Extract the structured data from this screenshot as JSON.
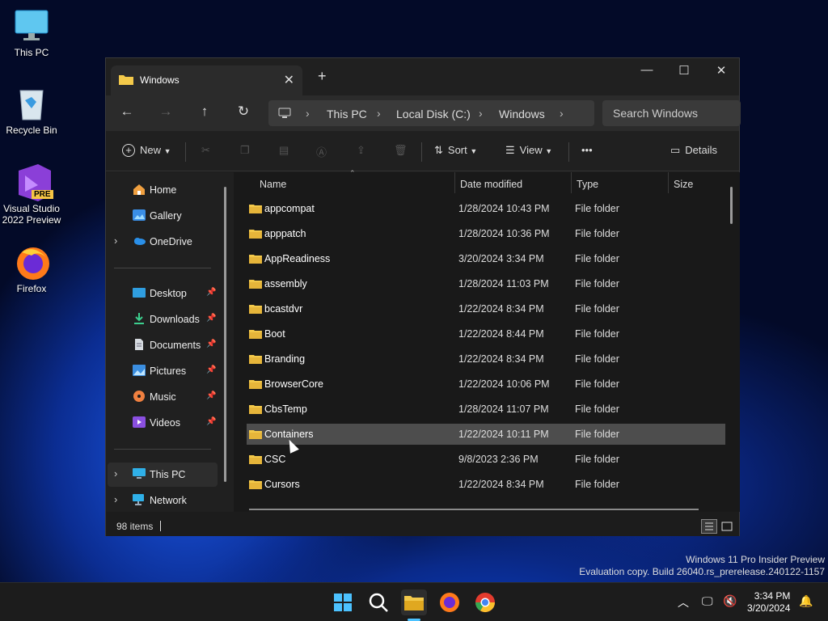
{
  "desktop": {
    "icons": [
      {
        "label": "This PC"
      },
      {
        "label": "Recycle Bin"
      },
      {
        "label": "Visual Studio 2022 Preview"
      },
      {
        "label": "Firefox"
      }
    ],
    "vs_badge": "PRE"
  },
  "window": {
    "tab_title": "Windows",
    "tab_close": "✕",
    "new_tab": "+",
    "controls": {
      "minimize": "—",
      "maximize": "☐",
      "close": "✕"
    }
  },
  "address": {
    "crumbs": [
      "This PC",
      "Local Disk (C:)",
      "Windows"
    ],
    "search_placeholder": "Search Windows"
  },
  "toolbar": {
    "new_label": "New",
    "sort_label": "Sort",
    "view_label": "View",
    "more_label": "•••",
    "details_label": "Details"
  },
  "nav": {
    "top": [
      {
        "label": "Home"
      },
      {
        "label": "Gallery"
      },
      {
        "label": "OneDrive"
      }
    ],
    "quick": [
      {
        "label": "Desktop"
      },
      {
        "label": "Downloads"
      },
      {
        "label": "Documents"
      },
      {
        "label": "Pictures"
      },
      {
        "label": "Music"
      },
      {
        "label": "Videos"
      }
    ],
    "bottom": [
      {
        "label": "This PC"
      },
      {
        "label": "Network"
      }
    ]
  },
  "columns": {
    "name": "Name",
    "date": "Date modified",
    "type": "Type",
    "size": "Size"
  },
  "files": [
    {
      "name": "appcompat",
      "date": "1/28/2024 10:43 PM",
      "type": "File folder"
    },
    {
      "name": "apppatch",
      "date": "1/28/2024 10:36 PM",
      "type": "File folder"
    },
    {
      "name": "AppReadiness",
      "date": "3/20/2024 3:34 PM",
      "type": "File folder"
    },
    {
      "name": "assembly",
      "date": "1/28/2024 11:03 PM",
      "type": "File folder"
    },
    {
      "name": "bcastdvr",
      "date": "1/22/2024 8:34 PM",
      "type": "File folder"
    },
    {
      "name": "Boot",
      "date": "1/22/2024 8:44 PM",
      "type": "File folder"
    },
    {
      "name": "Branding",
      "date": "1/22/2024 8:34 PM",
      "type": "File folder"
    },
    {
      "name": "BrowserCore",
      "date": "1/22/2024 10:06 PM",
      "type": "File folder"
    },
    {
      "name": "CbsTemp",
      "date": "1/28/2024 11:07 PM",
      "type": "File folder"
    },
    {
      "name": "Containers",
      "date": "1/22/2024 10:11 PM",
      "type": "File folder"
    },
    {
      "name": "CSC",
      "date": "9/8/2023 2:36 PM",
      "type": "File folder"
    },
    {
      "name": "Cursors",
      "date": "1/22/2024 8:34 PM",
      "type": "File folder"
    }
  ],
  "status": {
    "count": "98 items"
  },
  "watermark": {
    "line1": "Windows 11 Pro Insider Preview",
    "line2": "Evaluation copy. Build 26040.rs_prerelease.240122-1157"
  },
  "clock": {
    "time": "3:34 PM",
    "date": "3/20/2024"
  },
  "colors": {
    "folder": "#f3c94a",
    "accent": "#4cc2ff",
    "selected_row": "#4d4d4d"
  }
}
